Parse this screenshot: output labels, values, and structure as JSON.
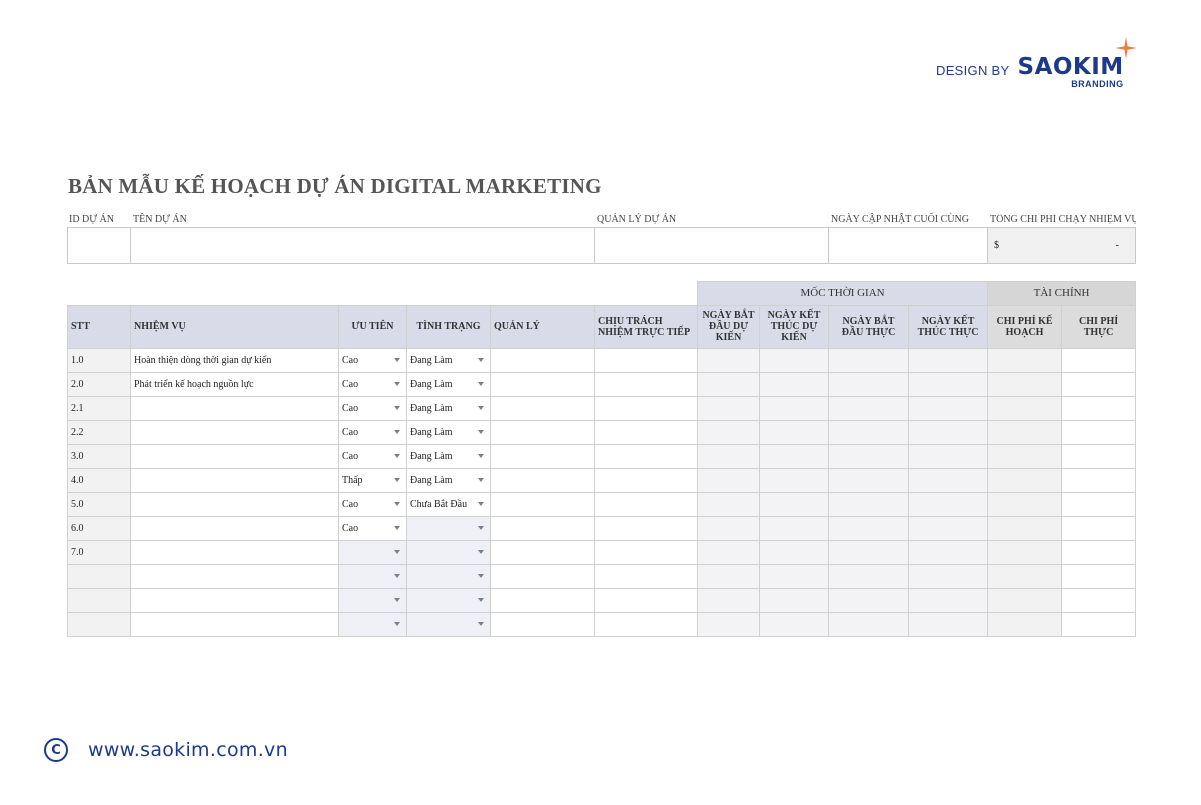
{
  "brand": {
    "design_by": "DESIGN BY",
    "logo": "SAOKIM",
    "logo_sub": "BRANDING",
    "accent": "#f07b3f",
    "color": "#1d3a8a"
  },
  "title": "BẢN MẪU KẾ HOẠCH DỰ ÁN DIGITAL MARKETING",
  "info_headers": {
    "id": "ID DỰ ÁN",
    "name": "TÊN DỰ ÁN",
    "manager": "QUẢN LÝ DỰ ÁN",
    "updated": "NGÀY CẬP NHẬT CUỐI CÙNG",
    "cost": "TỔNG CHI PHÍ CHẠY NHIỆM VỤ"
  },
  "info_values": {
    "currency": "$",
    "cost": "-"
  },
  "groups": {
    "timeline": "MỐC THỜI GIAN",
    "finance": "TÀI CHÍNH"
  },
  "columns": {
    "stt": "STT",
    "task": "NHIỆM VỤ",
    "priority": "ƯU TIÊN",
    "status": "TÌNH TRẠNG",
    "manager": "QUẢN LÝ",
    "responsible": "CHỊU TRÁCH NHIỆM TRỰC TIẾP",
    "plan_start": "NGÀY BẮT ĐẦU DỰ KIẾN",
    "plan_end": "NGÀY KẾT THÚC DỰ KIẾN",
    "actual_start": "NGÀY BẮT ĐẦU THỰC",
    "actual_end": "NGÀY KẾT THÚC THỰC",
    "plan_cost": "CHI PHÍ KẾ HOẠCH",
    "actual_cost": "CHI PHÍ THỰC"
  },
  "rows": [
    {
      "stt": "1.0",
      "task": "Hoàn thiện dòng thời gian dự kiến",
      "priority": "Cao",
      "status": "Đang Làm"
    },
    {
      "stt": "2.0",
      "task": "Phát triển kế hoạch nguồn lực",
      "priority": "Cao",
      "status": "Đang Làm"
    },
    {
      "stt": "2.1",
      "task": "",
      "priority": "Cao",
      "status": "Đang Làm"
    },
    {
      "stt": "2.2",
      "task": "",
      "priority": "Cao",
      "status": "Đang Làm"
    },
    {
      "stt": "3.0",
      "task": "",
      "priority": "Cao",
      "status": "Đang Làm"
    },
    {
      "stt": "4.0",
      "task": "",
      "priority": "Thấp",
      "status": "Đang Làm"
    },
    {
      "stt": "5.0",
      "task": "",
      "priority": "Cao",
      "status": "Chưa Bắt Đầu"
    },
    {
      "stt": "6.0",
      "task": "",
      "priority": "Cao",
      "status": ""
    },
    {
      "stt": "7.0",
      "task": "",
      "priority": "",
      "status": ""
    },
    {
      "stt": "",
      "task": "",
      "priority": "",
      "status": ""
    },
    {
      "stt": "",
      "task": "",
      "priority": "",
      "status": ""
    },
    {
      "stt": "",
      "task": "",
      "priority": "",
      "status": ""
    }
  ],
  "footer": {
    "url": "www.saokim.com.vn",
    "copyright_icon": "copyright-icon"
  }
}
